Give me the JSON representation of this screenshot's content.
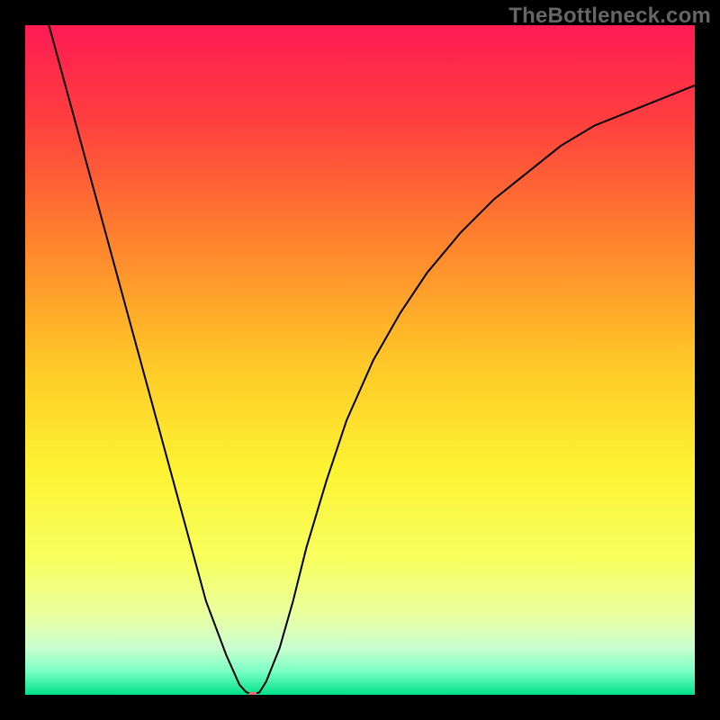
{
  "watermark": "TheBottleneck.com",
  "chart_data": {
    "type": "line",
    "title": "",
    "xlabel": "",
    "ylabel": "",
    "xlim": [
      0,
      100
    ],
    "ylim": [
      0,
      100
    ],
    "grid": false,
    "legend": false,
    "background_gradient_stops": [
      {
        "pos": 0.0,
        "color": "#ff1b54"
      },
      {
        "pos": 0.14,
        "color": "#ff3e3f"
      },
      {
        "pos": 0.3,
        "color": "#ff7a2e"
      },
      {
        "pos": 0.5,
        "color": "#ffc627"
      },
      {
        "pos": 0.66,
        "color": "#fdf232"
      },
      {
        "pos": 0.8,
        "color": "#f7ff5f"
      },
      {
        "pos": 0.88,
        "color": "#eaffa0"
      },
      {
        "pos": 0.93,
        "color": "#c9ffcf"
      },
      {
        "pos": 0.965,
        "color": "#7affc4"
      },
      {
        "pos": 1.0,
        "color": "#00e28a"
      }
    ],
    "series": [
      {
        "name": "curve",
        "stroke": "#000000",
        "stroke_width": 2,
        "x": [
          0,
          3,
          6,
          9,
          12,
          15,
          18,
          21,
          24,
          27,
          30,
          32,
          33,
          34,
          35,
          36,
          38,
          40,
          42,
          45,
          48,
          52,
          56,
          60,
          65,
          70,
          75,
          80,
          85,
          90,
          95,
          100
        ],
        "y": [
          113,
          102,
          91,
          80,
          69,
          58,
          47,
          36,
          25,
          14,
          6,
          1.5,
          0.4,
          0,
          0.4,
          2,
          7,
          14,
          22,
          32,
          41,
          50,
          57,
          63,
          69,
          74,
          78,
          82,
          85,
          87,
          89,
          91
        ]
      }
    ],
    "marker": {
      "name": "minimum-point",
      "x": 34,
      "y": 0,
      "color": "#e96a6a",
      "rx": 5,
      "ry": 3.5
    }
  }
}
